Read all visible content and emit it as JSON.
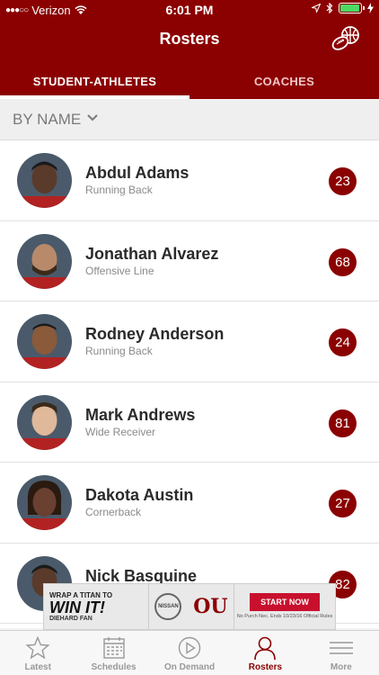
{
  "status_bar": {
    "carrier": "Verizon",
    "time": "6:01 PM"
  },
  "nav": {
    "title": "Rosters"
  },
  "tabs": [
    {
      "label": "STUDENT-ATHLETES",
      "active": true
    },
    {
      "label": "COACHES",
      "active": false
    }
  ],
  "filter": {
    "label": "BY NAME"
  },
  "athletes": [
    {
      "name": "Abdul Adams",
      "position": "Running Back",
      "number": "23"
    },
    {
      "name": "Jonathan Alvarez",
      "position": "Offensive Line",
      "number": "68"
    },
    {
      "name": "Rodney Anderson",
      "position": "Running Back",
      "number": "24"
    },
    {
      "name": "Mark Andrews",
      "position": "Wide Receiver",
      "number": "81"
    },
    {
      "name": "Dakota Austin",
      "position": "Cornerback",
      "number": "27"
    },
    {
      "name": "Nick Basquine",
      "position": "",
      "number": "82"
    }
  ],
  "ad": {
    "line1": "WRAP A TITAN TO",
    "line2": "WIN IT!",
    "line3": "DIEHARD FAN",
    "brand": "NISSAN",
    "school_logo": "OU",
    "cta": "START NOW",
    "fine_print": "No Purch Nec. Ends 10/23/16 Official Rules"
  },
  "tabbar": [
    {
      "label": "Latest",
      "icon": "star-icon",
      "active": false
    },
    {
      "label": "Schedules",
      "icon": "calendar-icon",
      "active": false
    },
    {
      "label": "On Demand",
      "icon": "play-icon",
      "active": false
    },
    {
      "label": "Rosters",
      "icon": "person-icon",
      "active": true
    },
    {
      "label": "More",
      "icon": "menu-icon",
      "active": false
    }
  ],
  "colors": {
    "brand": "#8b0000",
    "accent": "#c8102e",
    "battery": "#4cd964"
  },
  "avatar_skin_tones": [
    "#5a3a2a",
    "#b98a6a",
    "#8a5a3a",
    "#e0b89a",
    "#6a4030",
    "#5a3a2a"
  ]
}
